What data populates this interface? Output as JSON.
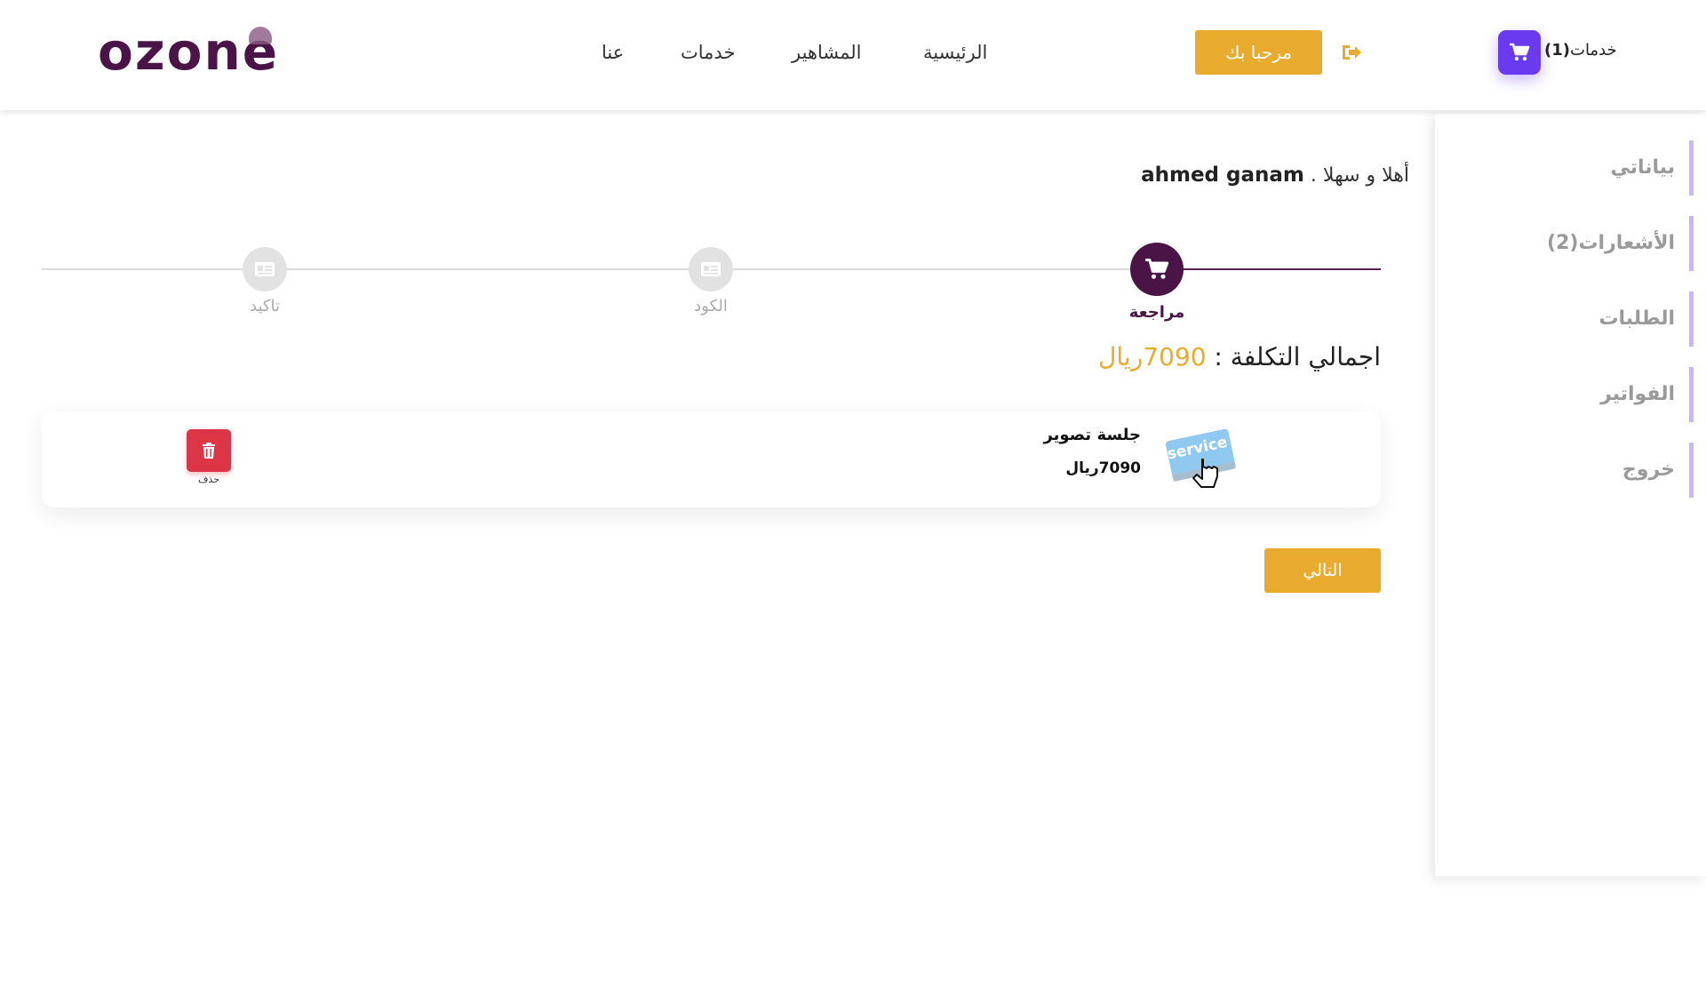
{
  "header": {
    "logo_text": "ozone",
    "nav": {
      "home": "الرئيسية",
      "celebrities": "المشاهير",
      "services": "خدمات",
      "about": "عنا"
    },
    "welcome_label": "مرحبا بك",
    "cart": {
      "label": "خدمات",
      "count": "(1)"
    }
  },
  "sidebar": {
    "items": [
      {
        "label": "بياناتي"
      },
      {
        "label": "الأشعارات(2)"
      },
      {
        "label": "الطلبات"
      },
      {
        "label": "الفواتير"
      },
      {
        "label": "خروج"
      }
    ]
  },
  "main": {
    "greeting_prefix": "أهلا و سهلا .",
    "user_name": "ahmed ganam",
    "steps": [
      {
        "label": "مراجعة",
        "active": true
      },
      {
        "label": "الكود",
        "active": false
      },
      {
        "label": "تاكيد",
        "active": false
      }
    ],
    "total_label": "اجمالي التكلفة :",
    "total_value": "7090ريال",
    "items": [
      {
        "image_text": "service",
        "name": "جلسة تصوير",
        "price": "7090ريال",
        "delete_label": "حذف"
      }
    ],
    "next_label": "التالي"
  },
  "colors": {
    "accent": "#e8ab2e",
    "brand": "#4a1446",
    "cart": "#6a3af0",
    "delete": "#dc3545",
    "sidebar_border": "#c9b8f5"
  }
}
